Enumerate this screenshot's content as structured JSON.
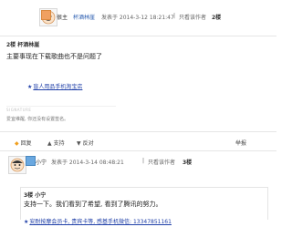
{
  "posts": [
    {
      "author": "很主",
      "author_name": "杯酒林崖",
      "posted_at": "发表于 2014-3-12 18:21:47",
      "only_author": "只看该作者",
      "floor": "2楼",
      "quote_header": "2楼 杯酒林崖",
      "content": "主要事现在下载歌曲也不是问题了",
      "link_text": "盲人用品手机淘宝店",
      "signature_label": "SIGNATURE",
      "signature": "爱宜维醒, 你还没有设置签名。",
      "actions": [
        "回复",
        "支持",
        "反对"
      ],
      "report": "举报"
    },
    {
      "author": "小宁",
      "posted_at": "发表于 2014-3-14 08:48:21",
      "only_author": "只看该作者",
      "floor": "3楼",
      "quote_header": "3楼 小宁",
      "content": "支持一下。我们看到了希望, 看到了腾讯的努力。",
      "link_text": "安耐按摩会员卡, 贵宾卡等, 感基手机微信: 13347851161"
    }
  ],
  "colors": {
    "link": "#1f3fa8",
    "accent_icon": "#f0a060"
  }
}
